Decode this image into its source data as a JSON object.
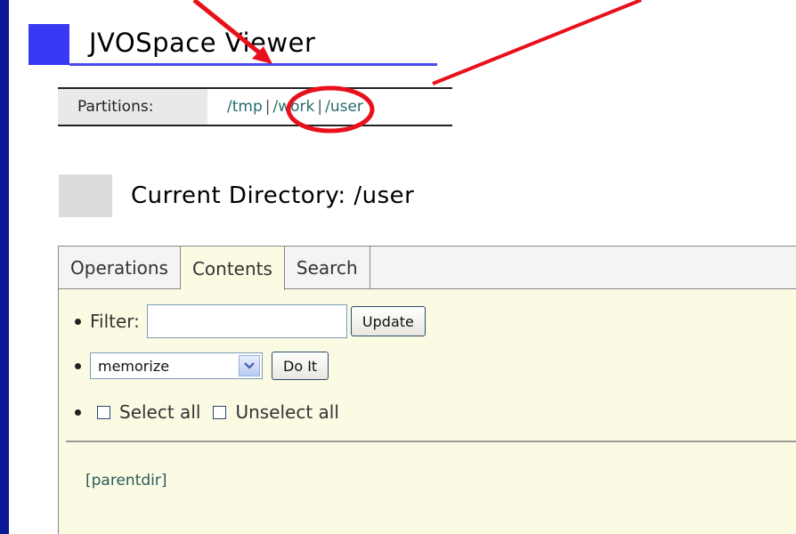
{
  "header": {
    "title": "JVOSpace Viewer"
  },
  "partitions": {
    "label": "Partitions:",
    "items": [
      "/tmp",
      "/work",
      "/user"
    ],
    "separator": "|"
  },
  "current_directory": {
    "text": "Current Directory: /user"
  },
  "tabs": [
    {
      "label": "Operations",
      "active": false
    },
    {
      "label": "Contents",
      "active": true
    },
    {
      "label": "Search",
      "active": false
    }
  ],
  "contents": {
    "filter_label": "Filter:",
    "filter_value": "",
    "update_label": "Update",
    "action_selected": "memorize",
    "do_it_label": "Do It",
    "select_all_label": "Select all",
    "unselect_all_label": "Unselect all",
    "parentdir_label": "[parentdir]"
  },
  "colors": {
    "frame": "#0a1a96",
    "annotation": "#e8101a",
    "panel_background": "#fbfbe4",
    "title_accent": "#3939f5"
  }
}
